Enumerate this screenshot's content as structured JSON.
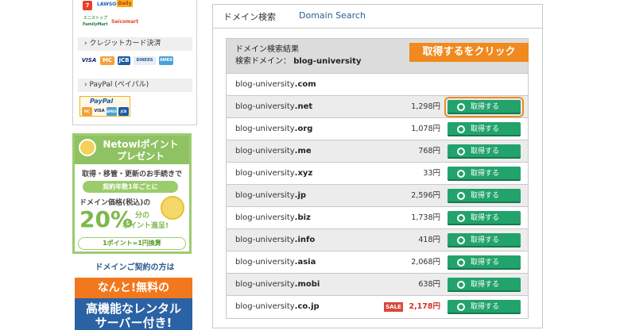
{
  "sidebar": {
    "conv_logos": [
      "LAWSON",
      "Daily",
      "Seicomart",
      "FamilyMart",
      "ミニストップ"
    ],
    "credit_head": "クレジットカード決済",
    "credit_cards": [
      "VISA",
      "MC",
      "JCB",
      "DINERS",
      "AMEX"
    ],
    "paypal_head": "PayPal (ペイパル)",
    "paypal_logo": "PayPal",
    "paypal_cards": [
      "MC",
      "VISA",
      "AMEX",
      "JCB"
    ],
    "netowl": {
      "title1": "Netowlポイント",
      "title2": "プレゼント",
      "line1": "取得・移管・更新のお手続きで",
      "pill": "契約年数1年ごとに",
      "line2": "ドメイン価格(税込)の",
      "big": "20%",
      "big_suffix": "分の",
      "big_suffix2": "ポイント進呈!",
      "bottom": "1ポイント=1円換算"
    },
    "contract": {
      "head": "ドメインご契約の方は",
      "orange": "なんと!無料の",
      "blue1": "高機能なレンタル",
      "blue2": "サーバー付き!"
    }
  },
  "main": {
    "title_jp": "ドメイン検索",
    "title_en": "Domain Search",
    "results_title": "ドメイン検索結果",
    "search_label": "検索ドメイン：",
    "search_domain": "blog-university",
    "callout": "取得するをクリック",
    "button_label": "取得する",
    "sale_label": "SALE",
    "rows": [
      {
        "base": "blog-university",
        "tld": ".com",
        "price": "",
        "sale": false,
        "button": false
      },
      {
        "base": "blog-university",
        "tld": ".net",
        "price": "1,298円",
        "sale": false,
        "button": true
      },
      {
        "base": "blog-university",
        "tld": ".org",
        "price": "1,078円",
        "sale": false,
        "button": true
      },
      {
        "base": "blog-university",
        "tld": ".me",
        "price": "768円",
        "sale": false,
        "button": true
      },
      {
        "base": "blog-university",
        "tld": ".xyz",
        "price": "33円",
        "sale": false,
        "button": true
      },
      {
        "base": "blog-university",
        "tld": ".jp",
        "price": "2,596円",
        "sale": false,
        "button": true
      },
      {
        "base": "blog-university",
        "tld": ".biz",
        "price": "1,738円",
        "sale": false,
        "button": true
      },
      {
        "base": "blog-university",
        "tld": ".info",
        "price": "418円",
        "sale": false,
        "button": true
      },
      {
        "base": "blog-university",
        "tld": ".asia",
        "price": "2,068円",
        "sale": false,
        "button": true
      },
      {
        "base": "blog-university",
        "tld": ".mobi",
        "price": "638円",
        "sale": false,
        "button": true
      },
      {
        "base": "blog-university",
        "tld": ".co.jp",
        "price": "2,178円",
        "sale": true,
        "button": true
      }
    ]
  },
  "colors": {
    "button_green": "#23a36c",
    "callout_orange": "#f08a1e",
    "sale_red": "#d7302a",
    "link_blue": "#2a5d8f"
  }
}
